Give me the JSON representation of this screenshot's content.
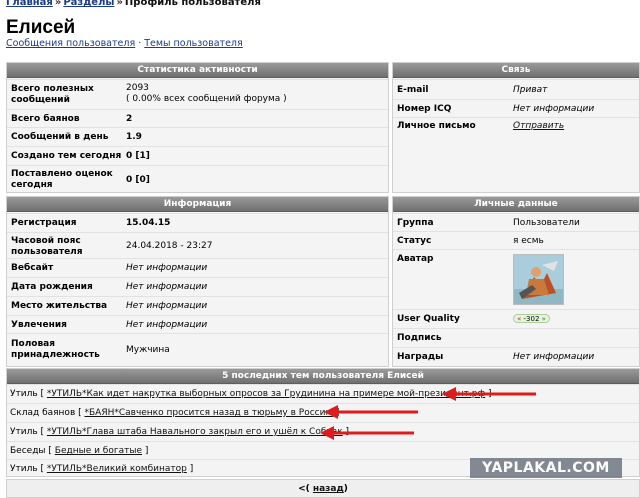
{
  "breadcrumb": {
    "home": "Главная",
    "sections": "Разделы",
    "current": "Профиль пользователя"
  },
  "page_title": "Елисей",
  "subnav": {
    "messages": "Сообщения пользователя",
    "topics": "Темы пользователя"
  },
  "stats": {
    "title": "Статистика активности",
    "total_posts_label": "Всего полезных сообщений",
    "total_posts_value": "2093",
    "total_posts_pct": "( 0.00% всех сообщений форума )",
    "bayans_label": "Всего баянов",
    "bayans_value": "2",
    "per_day_label": "Сообщений в день",
    "per_day_value": "1.9",
    "today_label": "Создано тем сегодня",
    "today_value": "0 [1]",
    "ratings_label": "Поставлено оценок сегодня",
    "ratings_value": "0 [0]"
  },
  "contact": {
    "title": "Связь",
    "email_label": "E-mail",
    "email_value": "Приват",
    "icq_label": "Номер ICQ",
    "icq_value": "Нет информации",
    "pm_label": "Личное письмо",
    "pm_value": "Отправить"
  },
  "info": {
    "title": "Информация",
    "reg_label": "Регистрация",
    "reg_value": "15.04.15",
    "tz_label": "Часовой пояс пользователя",
    "tz_value": "24.04.2018 - 23:27",
    "site_label": "Вебсайт",
    "site_value": "Нет информации",
    "birth_label": "Дата рождения",
    "birth_value": "Нет информации",
    "place_label": "Место жительства",
    "place_value": "Нет информации",
    "hobby_label": "Увлечения",
    "hobby_value": "Нет информации",
    "gender_label": "Половая принадлежность",
    "gender_value": "Мужчина"
  },
  "personal": {
    "title": "Личные данные",
    "group_label": "Группа",
    "group_value": "Пользователи",
    "status_label": "Статус",
    "status_value": "я есмь",
    "avatar_label": "Аватар",
    "quality_label": "User Quality",
    "quality_minus": "«",
    "quality_value": "-302",
    "quality_plus": "»",
    "signature_label": "Подпись",
    "awards_label": "Награды",
    "awards_value": "Нет информации"
  },
  "topics": {
    "title": "5 последних тем пользователя Елисей",
    "items": [
      {
        "section": "Утиль",
        "topic": "*УТИЛЬ*Как идет накрутка выборных опросов за Грудинина на примере мой-президент.рф"
      },
      {
        "section": "Склад баянов",
        "topic": "*БАЯН*Савченко просится назад в тюрьму в Россию"
      },
      {
        "section": "Утиль",
        "topic": "*УТИЛЬ*Глава штаба Навального закрыл его и ушёл к Собчак"
      },
      {
        "section": "Беседы",
        "topic": "Бедные и богатые"
      },
      {
        "section": "Утиль",
        "topic": "*УТИЛЬ*Великий комбинатор"
      }
    ]
  },
  "footer": {
    "prefix": "<(",
    "back": "назад",
    "suffix": ")"
  },
  "watermark": "YAPLAKAL.COM",
  "colors": {
    "link": "#1b3b8b",
    "header_bg": "#7f7f7f",
    "panel_bg": "#f4f4f4",
    "arrow": "#e01b1b"
  }
}
